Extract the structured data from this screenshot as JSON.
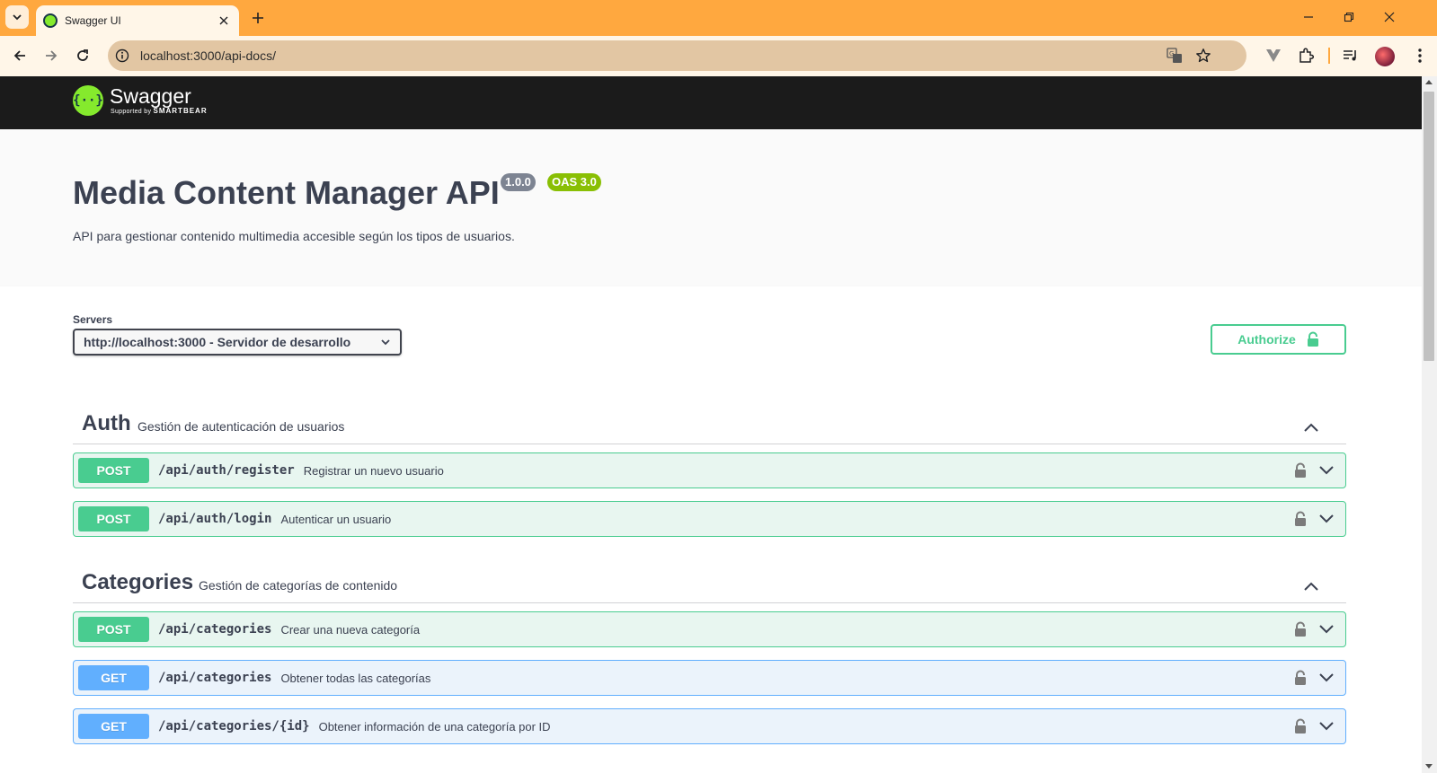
{
  "browser": {
    "tab_title": "Swagger UI",
    "url": "localhost:3000/api-docs/"
  },
  "colors": {
    "tabbar": "#ffa83f",
    "toolbar": "#fff6e8",
    "swagger_green": "#85ea2d",
    "post": "#49cc90",
    "get": "#61affe"
  },
  "icons": {
    "tab_search": "chevron-down-icon",
    "new_tab": "plus-icon",
    "back": "arrow-left-icon",
    "forward": "arrow-right-icon",
    "reload": "reload-icon",
    "site_info": "info-icon",
    "translate": "translate-icon",
    "bookmark": "star-icon",
    "lock": "lock-icon"
  },
  "swagger": {
    "logo_name": "Swagger",
    "logo_sub_prefix": "Supported by",
    "logo_sub_brand": "SMARTBEAR"
  },
  "api": {
    "title": "Media Content Manager API",
    "version": "1.0.0",
    "oas": "OAS 3.0",
    "description": "API para gestionar contenido multimedia accesible según los tipos de usuarios."
  },
  "servers": {
    "label": "Servers",
    "selected": "http://localhost:3000 - Servidor de desarrollo"
  },
  "authorize": {
    "label": "Authorize"
  },
  "tags": [
    {
      "name": "Auth",
      "description": "Gestión de autenticación de usuarios",
      "operations": [
        {
          "method": "POST",
          "path": "/api/auth/register",
          "summary": "Registrar un nuevo usuario"
        },
        {
          "method": "POST",
          "path": "/api/auth/login",
          "summary": "Autenticar un usuario"
        }
      ]
    },
    {
      "name": "Categories",
      "description": "Gestión de categorías de contenido",
      "operations": [
        {
          "method": "POST",
          "path": "/api/categories",
          "summary": "Crear una nueva categoría"
        },
        {
          "method": "GET",
          "path": "/api/categories",
          "summary": "Obtener todas las categorías"
        },
        {
          "method": "GET",
          "path": "/api/categories/{id}",
          "summary": "Obtener información de una categoría por ID"
        }
      ]
    }
  ]
}
